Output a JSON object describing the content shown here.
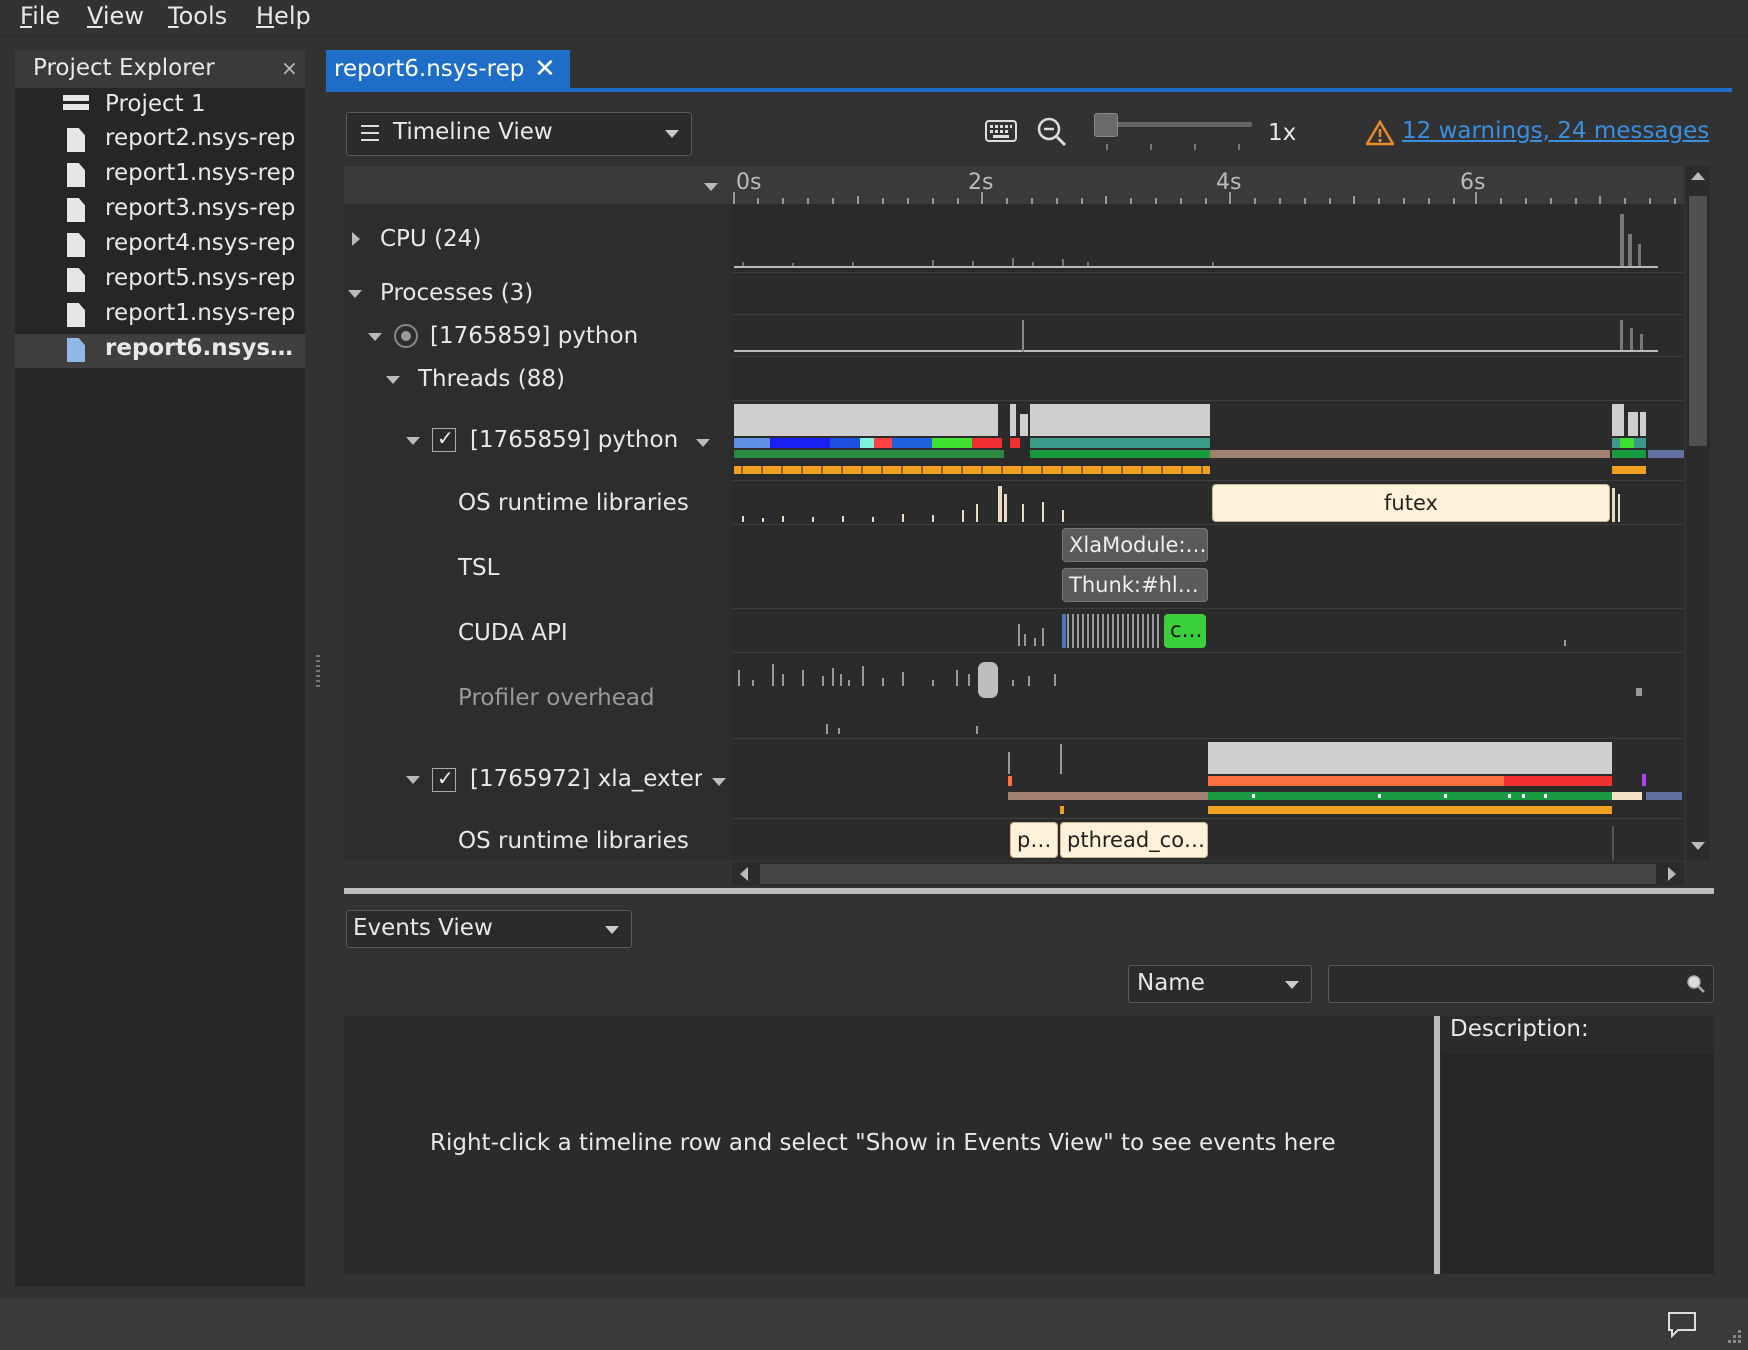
{
  "menu": [
    {
      "label": "File",
      "accel": "F",
      "rest": "ile"
    },
    {
      "label": "View",
      "accel": "V",
      "rest": "iew"
    },
    {
      "label": "Tools",
      "accel": "T",
      "rest": "ools"
    },
    {
      "label": "Help",
      "accel": "H",
      "rest": "elp"
    }
  ],
  "project_explorer": {
    "title": "Project Explorer",
    "close": "×",
    "items": [
      {
        "label": "Project 1",
        "icon": "project-icon"
      },
      {
        "label": "report2.nsys-rep",
        "icon": "file-icon"
      },
      {
        "label": "report1.nsys-rep",
        "icon": "file-icon"
      },
      {
        "label": "report3.nsys-rep",
        "icon": "file-icon"
      },
      {
        "label": "report4.nsys-rep",
        "icon": "file-icon"
      },
      {
        "label": "report5.nsys-rep",
        "icon": "file-icon"
      },
      {
        "label": "report1.nsys-rep",
        "icon": "file-icon"
      },
      {
        "label": "report6.nsys…",
        "icon": "file-icon",
        "selected": true
      }
    ]
  },
  "tab": {
    "label": "report6.nsys-rep",
    "close": "✕"
  },
  "toolbar": {
    "view_selector": "Timeline View",
    "zoom_level": "1x",
    "warnings": "12 warnings, 24 messages"
  },
  "timeline": {
    "ruler": [
      "0s",
      "2s",
      "4s",
      "6s"
    ],
    "rows": {
      "cpu": "CPU (24)",
      "processes": "Processes (3)",
      "proc_python": "[1765859] python",
      "threads": "Threads (88)",
      "thread_python": "[1765859] python",
      "osrt_1": "OS runtime libraries",
      "tsl": "TSL",
      "cuda_api": "CUDA API",
      "profiler_overhead": "Profiler overhead",
      "thread_xla": "[1765972] xla_exter",
      "osrt_2": "OS runtime libraries"
    },
    "events": {
      "futex": "futex",
      "xla_module": "XlaModule:…",
      "thunk": "Thunk:#hl…",
      "cuda_c": "c…",
      "p": "p…",
      "pthread": "pthread_co…"
    }
  },
  "events_view": {
    "selector": "Events View",
    "filter_field": "Name",
    "search_value": "",
    "empty_message": "Right-click a timeline row and select \"Show in Events View\" to see events here",
    "description_label": "Description:"
  },
  "colors": {
    "accent": "#1e6ec8",
    "link": "#3a8fe0",
    "warning": "#e8892a",
    "futex": "#fdf1d9",
    "cuda": "#3ccf3c"
  }
}
